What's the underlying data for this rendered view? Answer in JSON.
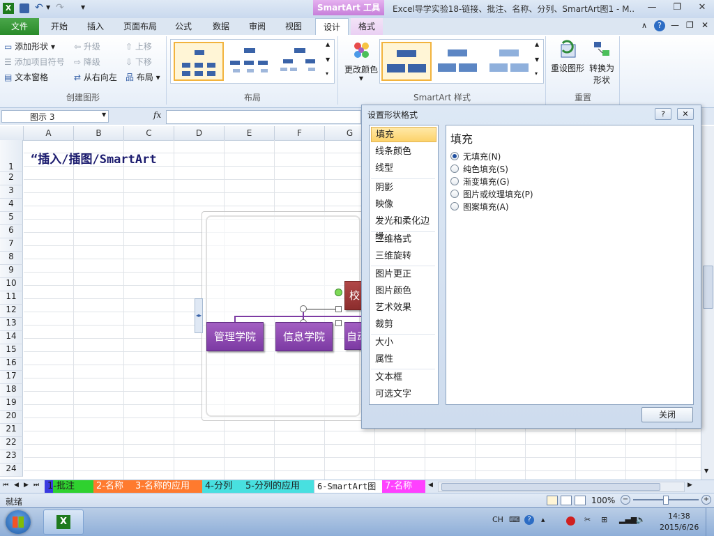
{
  "titlebar": {
    "contextual_header": "SmartArt 工具",
    "window_title": "Excel导学实验18-链接、批注、名称、分列、SmartArt图1 - M..",
    "qat": {
      "save": "save-icon",
      "undo": "undo-icon",
      "redo": "redo-icon"
    }
  },
  "tabs": {
    "file": "文件",
    "items": [
      "开始",
      "插入",
      "页面布局",
      "公式",
      "数据",
      "审阅",
      "视图"
    ],
    "design": "设计",
    "format": "格式"
  },
  "ribbon": {
    "create_group": {
      "label": "创建图形",
      "add_shape": "添加形状",
      "add_bullet": "添加项目符号",
      "text_pane": "文本窗格",
      "promote": "升级",
      "demote": "降级",
      "rtl": "从右向左",
      "move_up": "上移",
      "move_down": "下移",
      "layout": "布局"
    },
    "layout_group": {
      "label": "布局"
    },
    "styles_group": {
      "label": "SmartArt 样式",
      "change_colors": "更改颜色"
    },
    "reset_group": {
      "label": "重置",
      "reset_graphic": "重设图形",
      "convert": "转换为",
      "convert2": "形状"
    }
  },
  "formula_bar": {
    "name_box": "图示 3",
    "fx": "fx",
    "value": ""
  },
  "columns": [
    "A",
    "B",
    "C",
    "D",
    "E",
    "F",
    "G"
  ],
  "rows": [
    "1",
    "2",
    "3",
    "4",
    "5",
    "6",
    "7",
    "8",
    "9",
    "10",
    "11",
    "12",
    "13",
    "14",
    "15",
    "16",
    "17",
    "18",
    "19",
    "20",
    "21",
    "22",
    "23",
    "24"
  ],
  "cell_a1": "“插入/插图/SmartArt",
  "smartart": {
    "top_node": "校",
    "nodes": [
      "管理学院",
      "信息学院",
      "自动"
    ]
  },
  "dialog": {
    "title": "设置形状格式",
    "help": "?",
    "close_x": "✕",
    "nav": [
      "填充",
      "线条颜色",
      "线型",
      "阴影",
      "映像",
      "发光和柔化边缘",
      "三维格式",
      "三维旋转",
      "图片更正",
      "图片颜色",
      "艺术效果",
      "裁剪",
      "大小",
      "属性",
      "文本框",
      "可选文字"
    ],
    "selected_nav": "填充",
    "panel_title": "填充",
    "options": [
      "无填充(N)",
      "纯色填充(S)",
      "渐变填充(G)",
      "图片或纹理填充(P)",
      "图案填充(A)"
    ],
    "selected_option": "无填充(N)",
    "close_button": "关闭"
  },
  "sheets": [
    "1-批注",
    "2-名称",
    "3-名称的应用",
    "4-分列",
    "5-分列的应用",
    "6-SmartArt图",
    "7-名称"
  ],
  "active_sheet": "6-SmartArt图",
  "status": {
    "ready": "就绪",
    "zoom": "100%"
  },
  "taskbar": {
    "lang": "CH",
    "time": "14:38",
    "date": "2015/6/26"
  },
  "colors": {
    "accent_purple": "#8a44b0",
    "file_green": "#2a8b2a",
    "selected_orange": "#f2b33d"
  }
}
